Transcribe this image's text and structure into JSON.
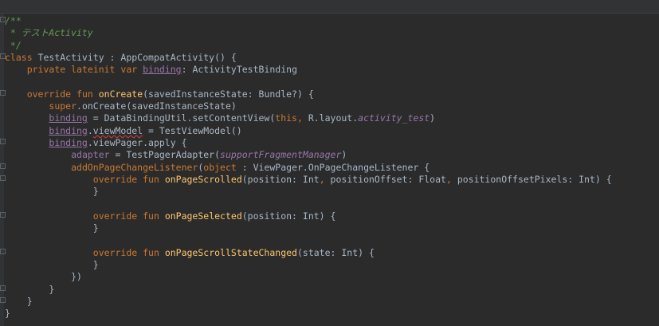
{
  "code": {
    "l1": "/**",
    "l2": " * テストActivity",
    "l3": " */",
    "l4_kw": "class",
    "l4_rest": " TestActivity : AppCompatActivity() {",
    "l5_kw": "private lateinit var",
    "l5_prop": "binding",
    "l5_rest": ": ActivityTestBinding",
    "l7_kw": "override fun",
    "l7_fn": "onCreate",
    "l7_rest": "(savedInstanceState: Bundle?) {",
    "l8_kw": "super",
    "l8_rest": ".onCreate(savedInstanceState)",
    "l9_prop": "binding",
    "l9_a": " = DataBindingUtil.setContentView(",
    "l9_this": "this",
    "l9_comma": ",",
    "l9_b": " R.layout.",
    "l9_field": "activity_test",
    "l9_c": ")",
    "l10_prop": "binding",
    "l10_dot": ".",
    "l10_field": "viewModel",
    "l10_rest": " = TestViewModel()",
    "l11_prop": "binding",
    "l11_dot": ".",
    "l11_field": "viewPager",
    "l11_rest": ".apply {",
    "l12_prop": "adapter",
    "l12_a": " = TestPagerAdapter(",
    "l12_field": "supportFragmentManager",
    "l12_b": ")",
    "l13_call": "addOnPageChangeListener",
    "l13_a": "(",
    "l13_kw": "object",
    "l13_b": " : ViewPager.OnPageChangeListener {",
    "l14_kw": "override fun",
    "l14_fn": "onPageScrolled",
    "l14_a": "(position: Int",
    "l14_c1": ",",
    "l14_b": " positionOffset: Float",
    "l14_c2": ",",
    "l14_c": " positionOffsetPixels: Int) {",
    "close_brace": "}",
    "l17_kw": "override fun",
    "l17_fn": "onPageSelected",
    "l17_rest": "(position: Int) {",
    "l20_kw": "override fun",
    "l20_fn": "onPageScrollStateChanged",
    "l20_rest": "(state: Int) {",
    "l22": "})"
  },
  "colors": {
    "background": "#2b2b2b",
    "keyword": "#cc7832",
    "function": "#ffc66d",
    "doc_comment": "#629755",
    "property": "#9876aa",
    "text": "#a9b7c6"
  }
}
